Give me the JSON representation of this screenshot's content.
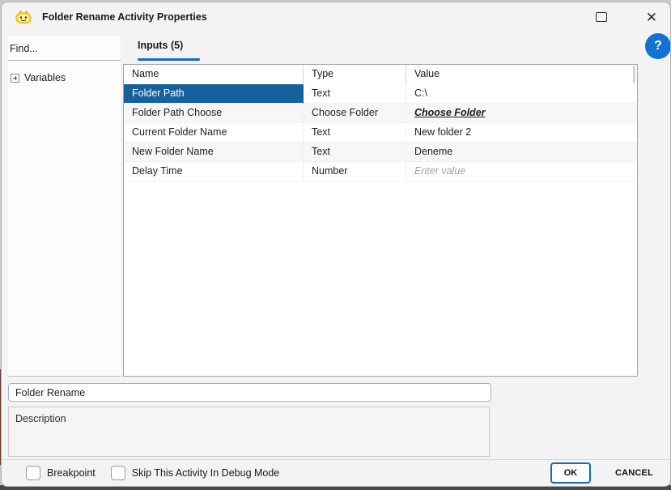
{
  "window": {
    "title": "Folder Rename Activity Properties",
    "close_glyph": "✕",
    "help_glyph": "?"
  },
  "sidebar": {
    "find_placeholder": "Find...",
    "tree": [
      {
        "label": "Variables",
        "expanded": false
      }
    ]
  },
  "tabs": [
    {
      "label": "Inputs (5)",
      "active": true
    }
  ],
  "table": {
    "columns": [
      "Name",
      "Type",
      "Value"
    ],
    "rows": [
      {
        "name": "Folder Path",
        "type": "Text",
        "value": "C:\\",
        "selected": true
      },
      {
        "name": "Folder Path Choose",
        "type": "Choose Folder",
        "value": "Choose Folder",
        "value_is_link": true
      },
      {
        "name": "Current Folder Name",
        "type": "Text",
        "value": "New folder 2"
      },
      {
        "name": "New Folder Name",
        "type": "Text",
        "value": "Deneme"
      },
      {
        "name": "Delay Time",
        "type": "Number",
        "value": "",
        "placeholder": "Enter value"
      }
    ]
  },
  "activity": {
    "name_value": "Folder Rename",
    "description_placeholder": "Description"
  },
  "footer": {
    "checkboxes": [
      {
        "label": "Breakpoint",
        "checked": false
      },
      {
        "label": "Skip This Activity In Debug Mode",
        "checked": false
      }
    ],
    "ok_label": "OK",
    "cancel_label": "CANCEL"
  },
  "colors": {
    "selection_blue": "#15619E",
    "accent_blue": "#1368C8",
    "help_blue": "#1272D4",
    "link_text": "#1A1A1A",
    "placeholder_gray": "#A3A3A3",
    "dialog_bg": "#F3F3F3"
  }
}
